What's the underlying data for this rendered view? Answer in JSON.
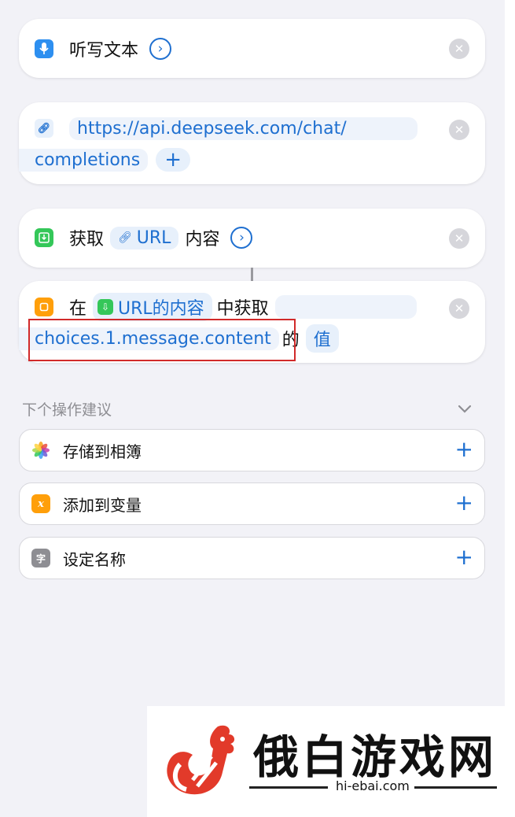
{
  "colors": {
    "accent": "#1e6fd0",
    "highlight_border": "#d12a2a"
  },
  "action1": {
    "icon": "microphone-icon",
    "label": "听写文本"
  },
  "action2": {
    "url_part1": "https://api.deepseek.com/chat/",
    "url_part2": "completions",
    "add_symbol": "+"
  },
  "action3": {
    "verb": "获取",
    "token": "URL",
    "suffix": "内容"
  },
  "action4": {
    "prefix": "在",
    "token": "URL的内容",
    "middle": "中获取",
    "key": "choices.1.message.content",
    "of": "的",
    "value": "值"
  },
  "suggestions": {
    "title": "下个操作建议",
    "items": [
      {
        "label": "存储到相簿",
        "icon": "photos-icon",
        "add": "+"
      },
      {
        "label": "添加到变量",
        "icon": "variable-icon",
        "icon_text": "x",
        "add": "+"
      },
      {
        "label": "设定名称",
        "icon": "rename-icon",
        "icon_text": "字",
        "add": "+"
      }
    ]
  },
  "watermark": {
    "title": "俄白游戏网",
    "url": "hi-ebai.com"
  }
}
